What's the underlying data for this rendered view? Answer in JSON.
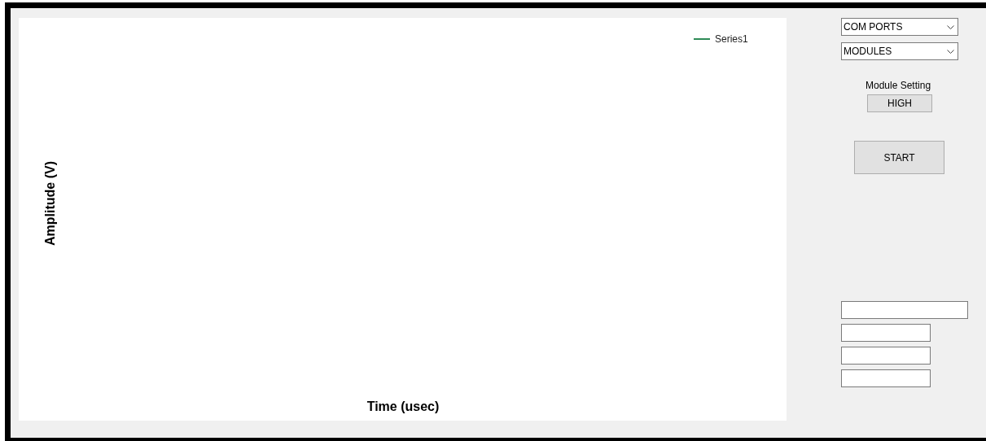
{
  "chart": {
    "legend": [
      {
        "name": "Series1",
        "color": "#2e8b57"
      }
    ],
    "ylabel": "Amplitude (V)",
    "xlabel": "Time (usec)"
  },
  "controls": {
    "dropdowns": [
      {
        "value": "COM PORTS"
      },
      {
        "value": "MODULES"
      }
    ],
    "module_setting": {
      "label": "Module Setting",
      "value": "HIGH"
    },
    "start_button": "START"
  },
  "fields": [
    {
      "kind": "wide"
    },
    {
      "kind": "narrow"
    },
    {
      "kind": "narrow"
    },
    {
      "kind": "narrow"
    }
  ]
}
